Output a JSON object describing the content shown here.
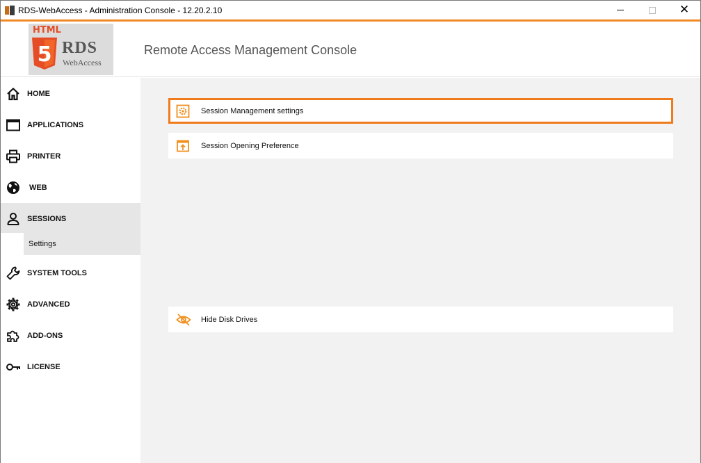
{
  "window": {
    "title": "RDS-WebAccess - Administration Console - 12.20.2.10",
    "accent_color": "#f08a24"
  },
  "header": {
    "title": "Remote Access Management Console",
    "logo": {
      "html_text": "HTML",
      "shield_digit": "5",
      "brand": "RDS",
      "brand_sub": "WebAccess"
    }
  },
  "sidebar": {
    "items": [
      {
        "label": "HOME",
        "icon": "home-icon"
      },
      {
        "label": "APPLICATIONS",
        "icon": "window-icon"
      },
      {
        "label": "PRINTER",
        "icon": "printer-icon"
      },
      {
        "label": "WEB",
        "icon": "globe-icon"
      },
      {
        "label": "SESSIONS",
        "icon": "user-icon",
        "active": true
      },
      {
        "label": "SYSTEM TOOLS",
        "icon": "wrench-icon"
      },
      {
        "label": "ADVANCED",
        "icon": "gear-icon"
      },
      {
        "label": "ADD-ONS",
        "icon": "puzzle-icon"
      },
      {
        "label": "LICENSE",
        "icon": "key-icon"
      }
    ],
    "sub_items": [
      {
        "label": "Settings",
        "parent": "SESSIONS",
        "active": true
      }
    ]
  },
  "main": {
    "settings": [
      {
        "label": "Session Management settings",
        "icon": "gear-box-icon",
        "selected": true
      },
      {
        "label": "Session Opening Preference",
        "icon": "upload-window-icon"
      },
      {
        "label": "Hide Disk Drives",
        "icon": "eye-slash-icon"
      }
    ],
    "icon_color": "#f0901e",
    "highlight_color": "#f07b1c"
  }
}
